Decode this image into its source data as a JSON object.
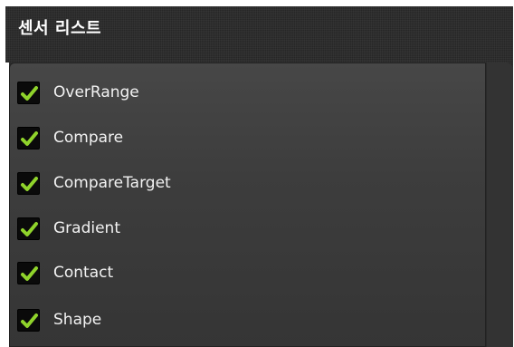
{
  "header": {
    "title": "센서 리스트"
  },
  "sensors": [
    {
      "label": "OverRange",
      "checked": true
    },
    {
      "label": "Compare",
      "checked": true
    },
    {
      "label": "CompareTarget",
      "checked": true
    },
    {
      "label": "Gradient",
      "checked": true
    },
    {
      "label": "Contact",
      "checked": true
    },
    {
      "label": "Shape",
      "checked": true
    }
  ],
  "colors": {
    "check": "#8fd32b",
    "panel": "#262626",
    "list": "#404040"
  },
  "icons": {
    "checkbox_mark": "check-icon"
  }
}
